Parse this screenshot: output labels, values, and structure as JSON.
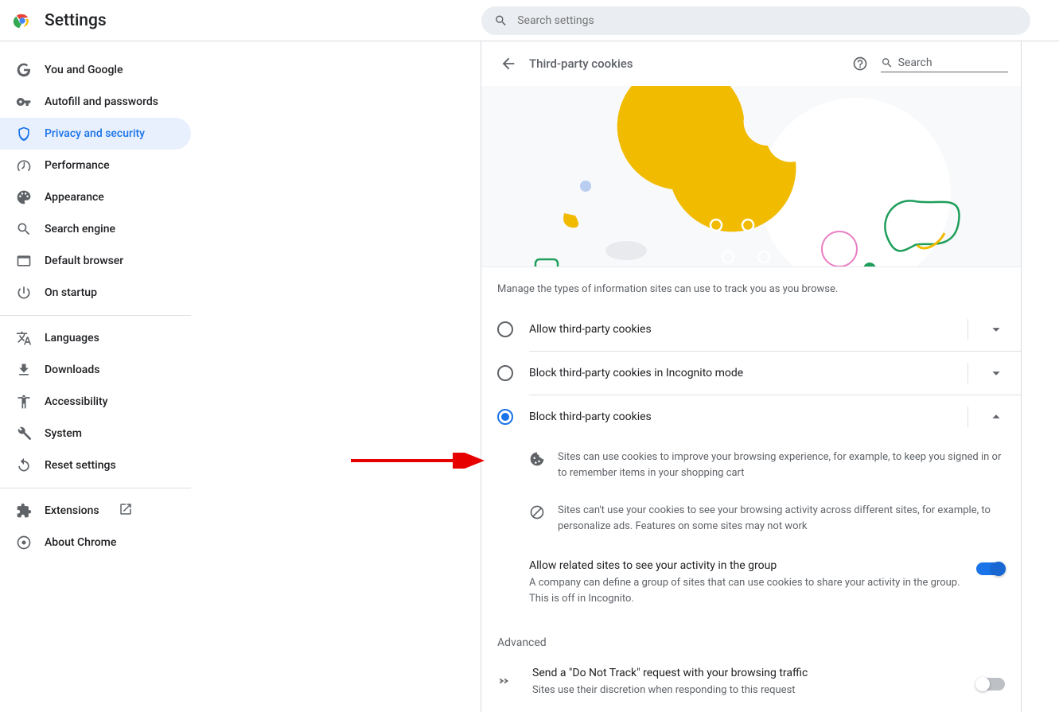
{
  "header": {
    "title": "Settings",
    "search_placeholder": "Search settings"
  },
  "sidebar": {
    "items": [
      {
        "label": "You and Google"
      },
      {
        "label": "Autofill and passwords"
      },
      {
        "label": "Privacy and security"
      },
      {
        "label": "Performance"
      },
      {
        "label": "Appearance"
      },
      {
        "label": "Search engine"
      },
      {
        "label": "Default browser"
      },
      {
        "label": "On startup"
      }
    ],
    "items2": [
      {
        "label": "Languages"
      },
      {
        "label": "Downloads"
      },
      {
        "label": "Accessibility"
      },
      {
        "label": "System"
      },
      {
        "label": "Reset settings"
      }
    ],
    "items3": [
      {
        "label": "Extensions"
      },
      {
        "label": "About Chrome"
      }
    ]
  },
  "panel": {
    "title": "Third-party cookies",
    "search_placeholder": "Search",
    "description": "Manage the types of information sites can use to track you as you browse.",
    "options": [
      {
        "label": "Allow third-party cookies"
      },
      {
        "label": "Block third-party cookies in Incognito mode"
      },
      {
        "label": "Block third-party cookies"
      }
    ],
    "details": [
      "Sites can use cookies to improve your browsing experience, for example, to keep you signed in or to remember items in your shopping cart",
      "Sites can't use your cookies to see your browsing activity across different sites, for example, to personalize ads. Features on some sites may not work"
    ],
    "related": {
      "title": "Allow related sites to see your activity in the group",
      "sub": "A company can define a group of sites that can use cookies to share your activity in the group. This is off in Incognito."
    },
    "advanced": {
      "heading": "Advanced",
      "dnt_title": "Send a \"Do Not Track\" request with your browsing traffic",
      "dnt_sub": "Sites use their discretion when responding to this request"
    }
  }
}
